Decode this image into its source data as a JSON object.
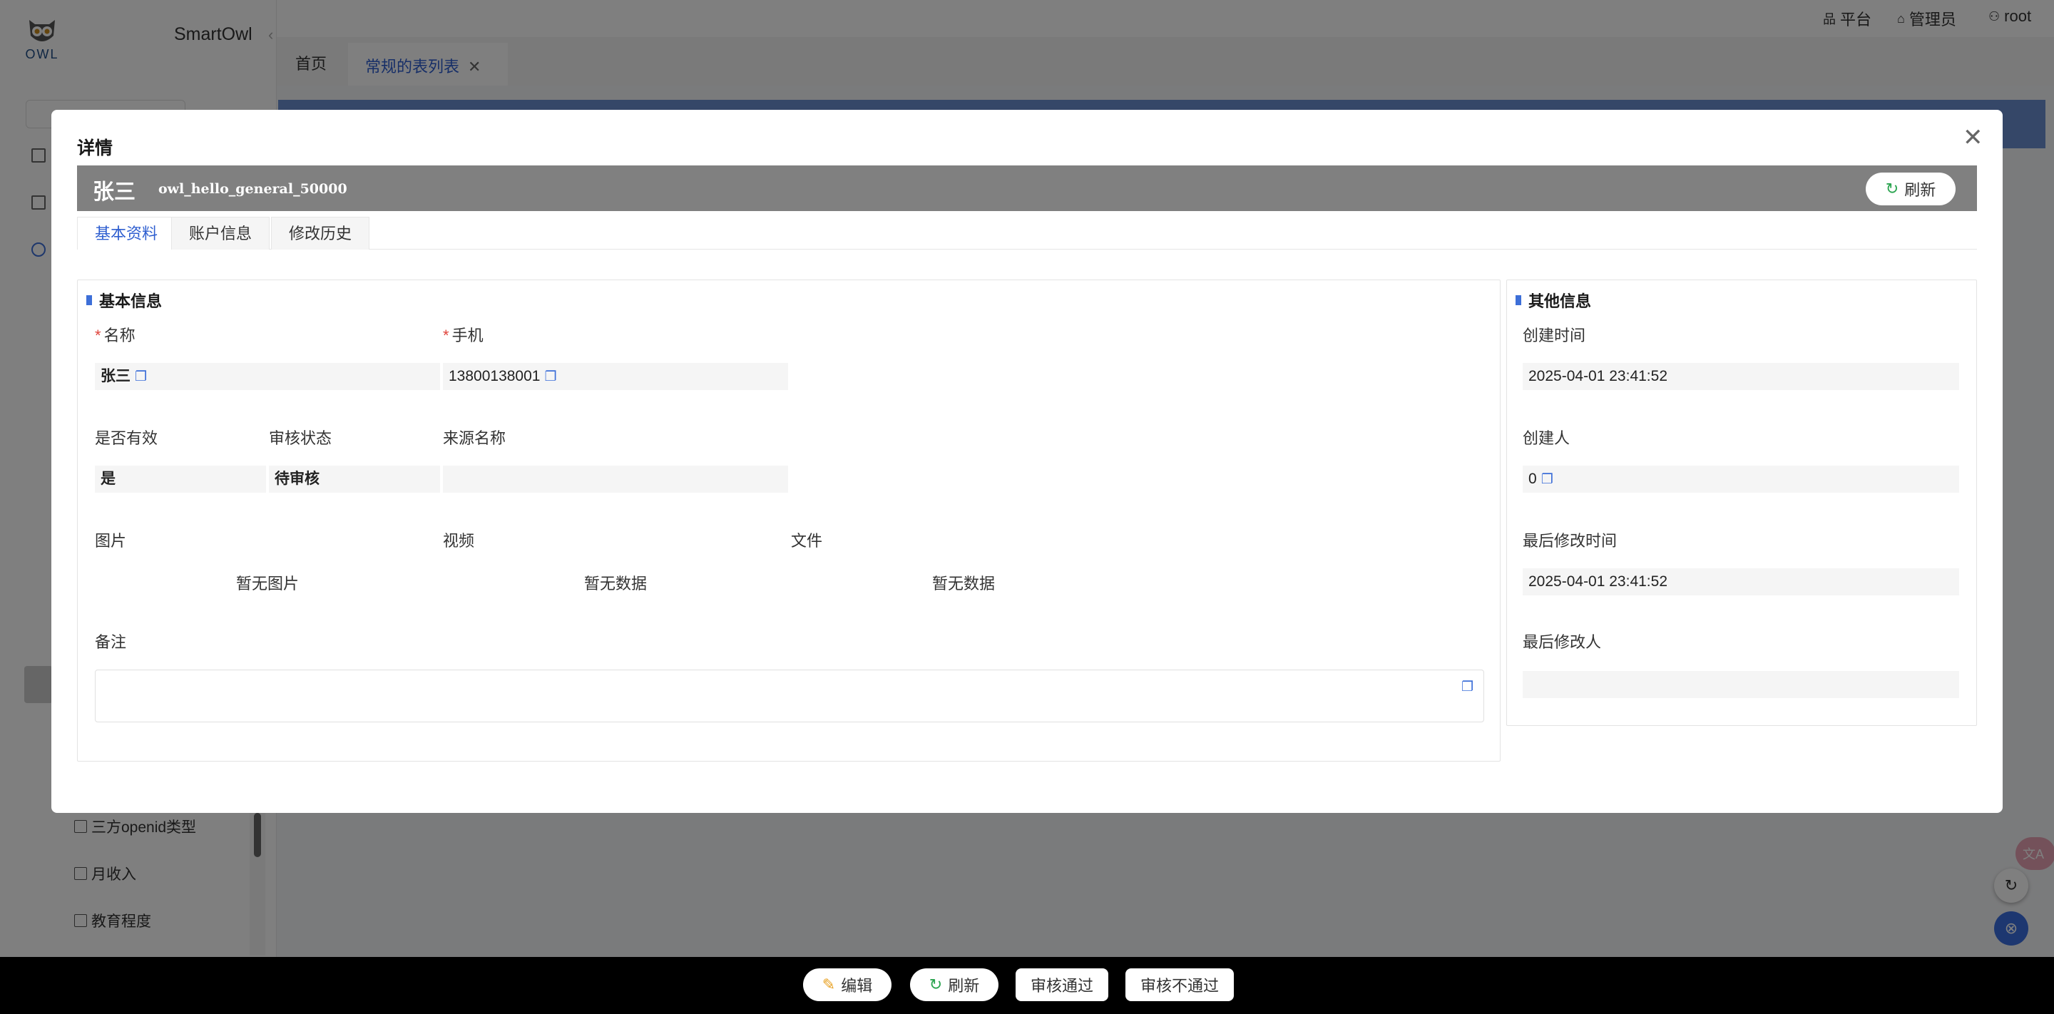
{
  "app": {
    "name": "SmartOwl",
    "logo_text": "OWL",
    "collapse_glyph": "‹"
  },
  "topbar": {
    "links": [
      {
        "icon": "sitemap-icon",
        "glyph": "品",
        "label": "平台"
      },
      {
        "icon": "admin-icon",
        "glyph": "⌂",
        "label": "管理员"
      },
      {
        "icon": "user-icon",
        "glyph": "⚇",
        "label": "root"
      }
    ]
  },
  "page_tabs": {
    "home": "首页",
    "current": "常规的表列表",
    "close_glyph": "✕"
  },
  "sidebar": {
    "items": [
      {
        "label": "三方openid类型"
      },
      {
        "label": "月收入"
      },
      {
        "label": "教育程度"
      }
    ]
  },
  "dialog": {
    "title": "详情",
    "close_glyph": "✕",
    "record": {
      "name": "张三",
      "id": "owl_hello_general_50000",
      "refresh_label": "刷新"
    },
    "tabs": [
      {
        "label": "基本资料",
        "active": true
      },
      {
        "label": "账户信息",
        "active": false
      },
      {
        "label": "修改历史",
        "active": false
      }
    ],
    "basic": {
      "title": "基本信息",
      "name_label": "名称",
      "name_value": "张三",
      "phone_label": "手机",
      "phone_value": "13800138001",
      "valid_label": "是否有效",
      "valid_value": "是",
      "audit_label": "审核状态",
      "audit_value": "待审核",
      "source_label": "来源名称",
      "source_value": "",
      "image_label": "图片",
      "image_empty": "暂无图片",
      "video_label": "视频",
      "video_empty": "暂无数据",
      "file_label": "文件",
      "file_empty": "暂无数据",
      "remark_label": "备注",
      "remark_value": ""
    },
    "other": {
      "title": "其他信息",
      "created_time_label": "创建时间",
      "created_time_value": "2025-04-01 23:41:52",
      "creator_label": "创建人",
      "creator_value": "0",
      "modified_time_label": "最后修改时间",
      "modified_time_value": "2025-04-01 23:41:52",
      "modifier_label": "最后修改人",
      "modifier_value": ""
    }
  },
  "bottom_bar": {
    "edit_label": "编辑",
    "refresh_label": "刷新",
    "approve_label": "审核通过",
    "reject_label": "审核不通过"
  },
  "fab": {
    "translate_glyph": "文A",
    "refresh_glyph": "↻",
    "close_glyph": "⊗"
  },
  "colors": {
    "accent": "#3d6fd8",
    "tab_active": "#2f5fd0",
    "record_bar": "#808080",
    "required": "#e0443c",
    "refresh_icon": "#2aa44f",
    "edit_icon": "#e8a020"
  }
}
